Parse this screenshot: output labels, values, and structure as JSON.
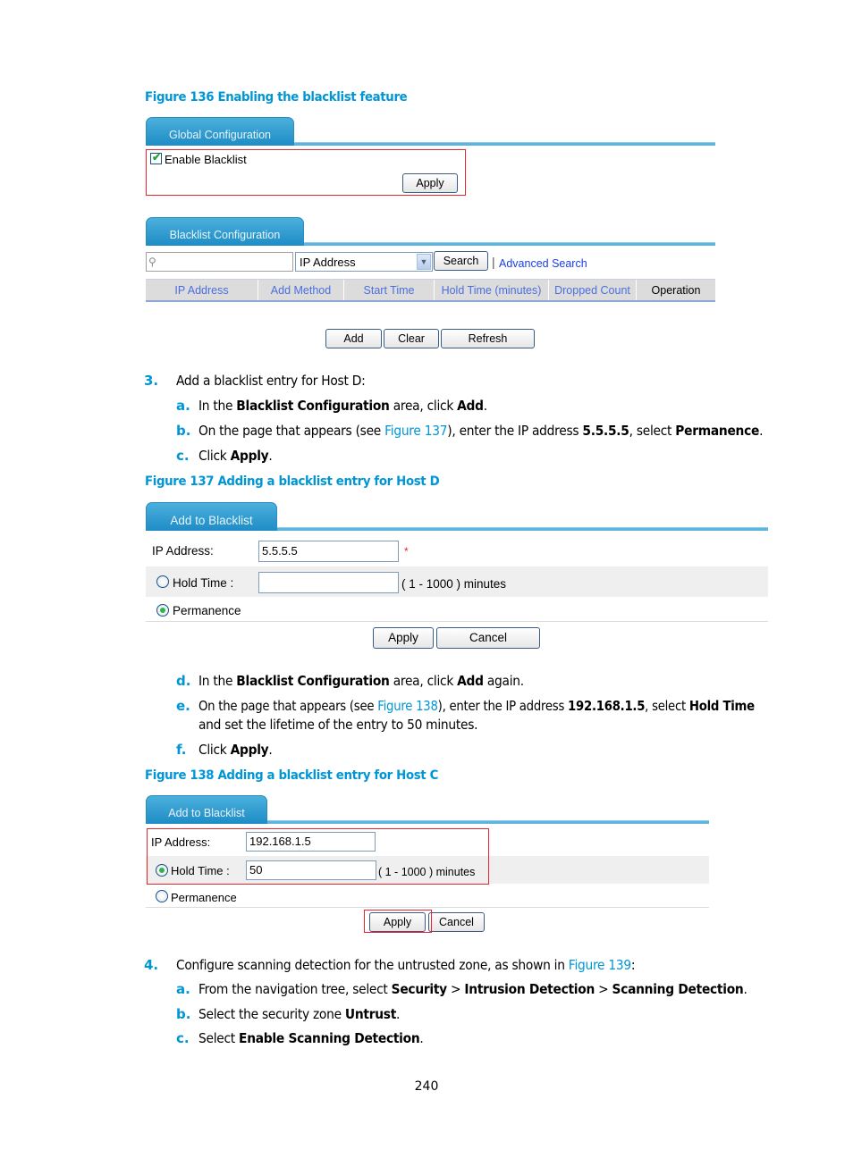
{
  "figure136": {
    "caption": "Figure 136 Enabling the blacklist feature",
    "global_tab": "Global Configuration",
    "enable_blacklist_label": "Enable Blacklist",
    "enable_blacklist_checked": true,
    "apply_label": "Apply",
    "blacklist_tab": "Blacklist Configuration",
    "search_placeholder": "",
    "search_field_select": "IP Address",
    "search_label": "Search",
    "separator": "|",
    "advanced_search_label": "Advanced Search",
    "table_headers": [
      "IP Address",
      "Add Method",
      "Start Time",
      "Hold Time (minutes)",
      "Dropped Count",
      "Operation"
    ],
    "add_label": "Add",
    "clear_label": "Clear",
    "refresh_label": "Refresh"
  },
  "step3": {
    "number": "3.",
    "text": "Add a blacklist entry for Host D:",
    "substeps": [
      {
        "letter": "a.",
        "parts": [
          "In the ",
          "Blacklist Configuration",
          " area, click ",
          "Add",
          "."
        ]
      },
      {
        "letter": "b.",
        "parts": [
          "On the page that appears (see ",
          "Figure 137",
          "), enter the IP address ",
          "5.5.5.5",
          ", select ",
          "Permanence",
          "."
        ]
      },
      {
        "letter": "c.",
        "parts": [
          "Click ",
          "Apply",
          "."
        ]
      }
    ]
  },
  "figure137": {
    "caption": "Figure 137 Adding a blacklist entry for Host D",
    "tab": "Add to Blacklist",
    "ip_label": "IP Address:",
    "ip_value": "5.5.5.5",
    "required_mark": "*",
    "hold_time_label": "Hold Time :",
    "hold_time_value": "",
    "hold_time_range": "( 1 - 1000 ) minutes",
    "permanence_label": "Permanence",
    "selected_option": "Permanence",
    "apply_label": "Apply",
    "cancel_label": "Cancel"
  },
  "step3_cont": {
    "substeps": [
      {
        "letter": "d.",
        "parts": [
          "In the ",
          "Blacklist Configuration",
          " area, click ",
          "Add",
          " again."
        ]
      },
      {
        "letter": "e.",
        "parts": [
          "On the page that appears (see ",
          "Figure 138",
          "), enter the IP address ",
          "192.168.1.5",
          ", select ",
          "Hold Time"
        ],
        "line2": "and set the lifetime of the entry to 50 minutes."
      },
      {
        "letter": "f.",
        "parts": [
          "Click ",
          "Apply",
          "."
        ]
      }
    ]
  },
  "figure138": {
    "caption": "Figure 138 Adding a blacklist entry for Host C",
    "tab": "Add to Blacklist",
    "ip_label": "IP Address:",
    "ip_value": "192.168.1.5",
    "hold_time_label": "Hold Time :",
    "hold_time_value": "50",
    "hold_time_range": "( 1 - 1000 ) minutes",
    "permanence_label": "Permanence",
    "selected_option": "Hold Time",
    "apply_label": "Apply",
    "cancel_label": "Cancel"
  },
  "step4": {
    "number": "4.",
    "parts": [
      "Configure scanning detection for the untrusted zone, as shown in ",
      "Figure 139",
      ":"
    ],
    "substeps": [
      {
        "letter": "a.",
        "parts": [
          "From the navigation tree, select ",
          "Security",
          " > ",
          "Intrusion Detection",
          " > ",
          "Scanning Detection",
          "."
        ]
      },
      {
        "letter": "b.",
        "parts": [
          "Select the security zone ",
          "Untrust",
          "."
        ]
      },
      {
        "letter": "c.",
        "parts": [
          "Select ",
          "Enable Scanning Detection",
          "."
        ]
      }
    ]
  },
  "page_number": "240",
  "colors": {
    "accent": "#0096d6",
    "highlight_box": "#e8242c",
    "tab_blue": "#2a93cb",
    "header_link": "#4a6ee0"
  }
}
